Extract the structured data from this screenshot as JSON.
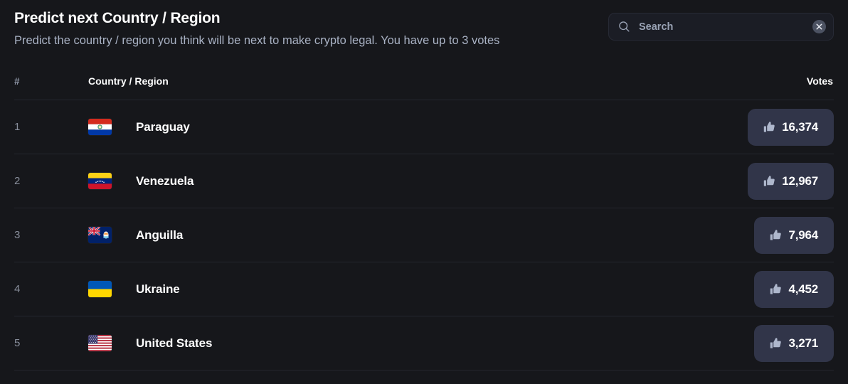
{
  "header": {
    "title": "Predict next Country / Region",
    "subtitle": "Predict the country / region you think will be next to make crypto legal. You have up to 3 votes"
  },
  "search": {
    "placeholder": "Search",
    "value": "",
    "icon": "search-icon",
    "clear_icon": "close-circle-icon"
  },
  "table": {
    "columns": {
      "rank": "#",
      "name": "Country / Region",
      "votes": "Votes"
    },
    "rows": [
      {
        "rank": "1",
        "name": "Paraguay",
        "votes": "16,374",
        "flag": "py"
      },
      {
        "rank": "2",
        "name": "Venezuela",
        "votes": "12,967",
        "flag": "ve"
      },
      {
        "rank": "3",
        "name": "Anguilla",
        "votes": "7,964",
        "flag": "ai"
      },
      {
        "rank": "4",
        "name": "Ukraine",
        "votes": "4,452",
        "flag": "ua"
      },
      {
        "rank": "5",
        "name": "United States",
        "votes": "3,271",
        "flag": "us"
      }
    ]
  },
  "colors": {
    "background": "#16171b",
    "vote_button": "#313549",
    "divider": "#24262e",
    "muted_text": "#888e9b",
    "subtitle_text": "#a9b2c4"
  }
}
